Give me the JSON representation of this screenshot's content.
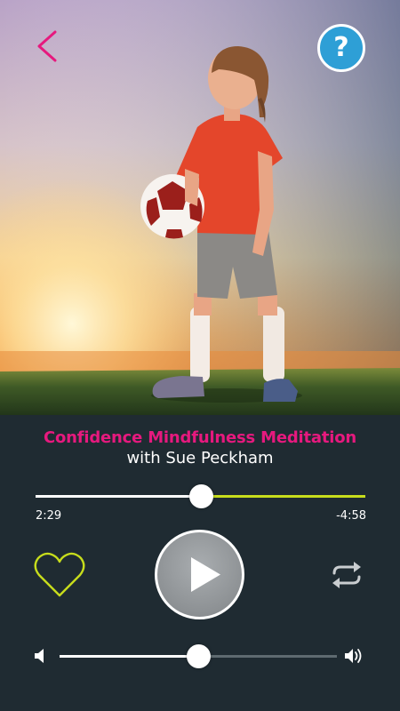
{
  "hero": {
    "image": "girl-with-soccer-ball-at-sunset",
    "back_icon": "chevron-left-icon",
    "help_icon": "question-mark-icon",
    "help_label": "?"
  },
  "track": {
    "title": "Confidence Mindfulness Meditation",
    "artist": "with Sue Peckham"
  },
  "progress": {
    "elapsed": "2:29",
    "remaining": "-4:58",
    "fraction": 0.5
  },
  "controls": {
    "favorite_icon": "heart-outline-icon",
    "play_icon": "play-icon",
    "repeat_icon": "repeat-icon"
  },
  "volume": {
    "low_icon": "volume-low-icon",
    "high_icon": "volume-high-icon",
    "fraction": 0.5
  },
  "colors": {
    "accent_pink": "#e6197e",
    "accent_lime": "#c7dd1c",
    "help_blue": "#2e9fd6",
    "panel_bg": "#1f2b32"
  }
}
